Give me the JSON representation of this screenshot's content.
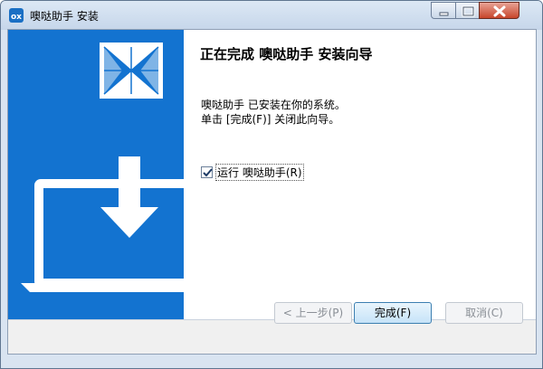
{
  "window": {
    "title": "噢哒助手 安装",
    "app_icon": "app-logo-icon",
    "controls": {
      "minimize_icon": "minimize-icon",
      "maximize_icon": "maximize-icon",
      "close_icon": "close-icon"
    }
  },
  "banner": {
    "logo_icon": "triangle-mosaic-logo",
    "illustration": "laptop-download-illustration",
    "color": "#1373d0"
  },
  "content": {
    "heading": "正在完成 噢哒助手 安装向导",
    "message_line1": "噢哒助手 已安装在你的系统。",
    "message_line2": "单击 [完成(F)] 关闭此向导。",
    "run_checkbox": {
      "label": "运行 噢哒助手(R)",
      "checked": true
    }
  },
  "buttons": {
    "back": "< 上一步(P)",
    "finish": "完成(F)",
    "cancel": "取消(C)"
  }
}
